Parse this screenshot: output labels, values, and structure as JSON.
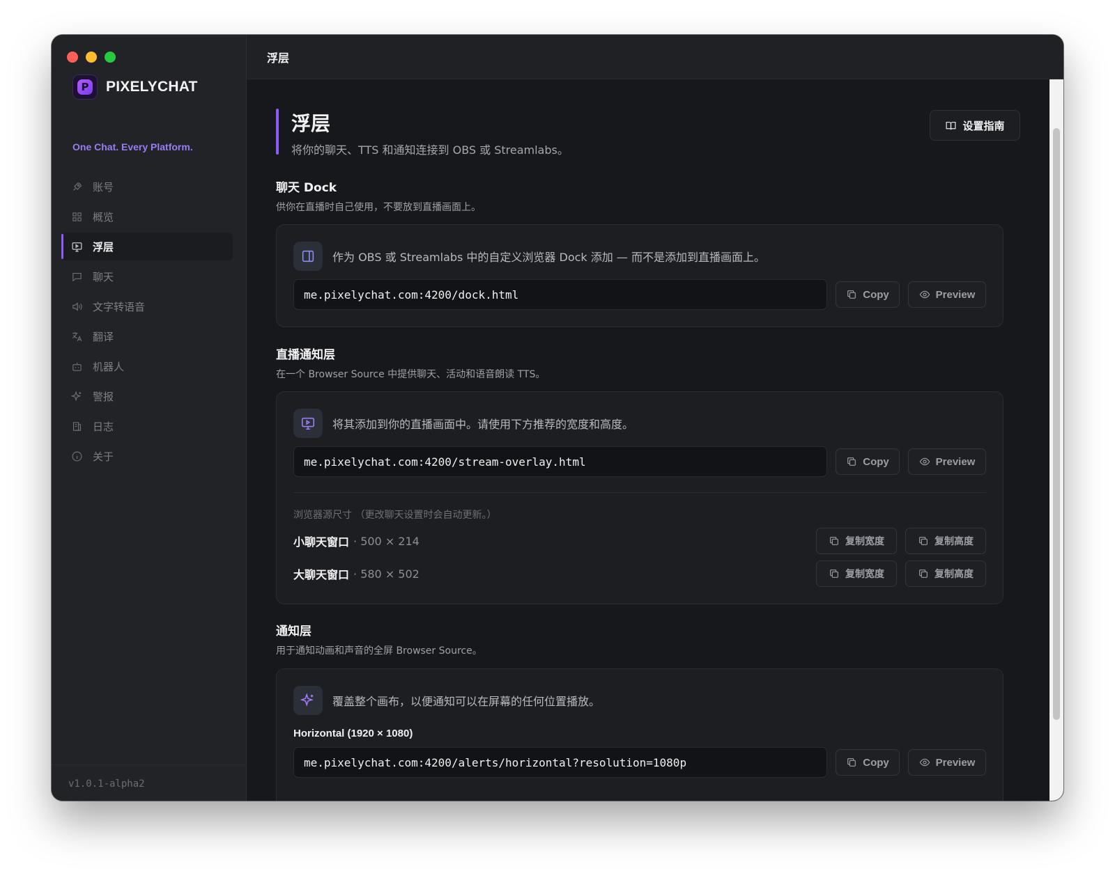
{
  "app": {
    "name": "PIXELYCHAT",
    "tagline": "One Chat. Every Platform.",
    "version": "v1.0.1-alpha2",
    "accent_color": "#8b5cf6"
  },
  "sidebar": {
    "items": [
      {
        "label": "账号",
        "icon": "rocket-icon"
      },
      {
        "label": "概览",
        "icon": "grid-icon"
      },
      {
        "label": "浮层",
        "icon": "monitor-play-icon",
        "active": true
      },
      {
        "label": "聊天",
        "icon": "chat-bubble-icon"
      },
      {
        "label": "文字转语音",
        "icon": "speaker-icon"
      },
      {
        "label": "翻译",
        "icon": "translate-icon"
      },
      {
        "label": "机器人",
        "icon": "bot-icon"
      },
      {
        "label": "警报",
        "icon": "sparkles-icon"
      },
      {
        "label": "日志",
        "icon": "log-icon"
      },
      {
        "label": "关于",
        "icon": "info-icon"
      }
    ]
  },
  "topbar": {
    "title": "浮层"
  },
  "page": {
    "title": "浮层",
    "subtitle": "将你的聊天、TTS 和通知连接到 OBS 或 Streamlabs。",
    "guide_button": "设置指南"
  },
  "buttons": {
    "copy": "Copy",
    "preview": "Preview",
    "copy_width": "复制宽度",
    "copy_height": "复制高度"
  },
  "dock": {
    "title": "聊天 Dock",
    "desc": "供你在直播时自己使用，不要放到直播画面上。",
    "info": "作为 OBS 或 Streamlabs 中的自定义浏览器 Dock 添加 — 而不是添加到直播画面上。",
    "url": "me.pixelychat.com:4200/dock.html"
  },
  "stream_overlay": {
    "title": "直播通知层",
    "desc": "在一个 Browser Source 中提供聊天、活动和语音朗读 TTS。",
    "info": "将其添加到你的直播画面中。请使用下方推荐的宽度和高度。",
    "url": "me.pixelychat.com:4200/stream-overlay.html",
    "dims_label": "浏览器源尺寸 （更改聊天设置时会自动更新。）",
    "sizes": [
      {
        "name": "小聊天窗口",
        "value": "· 500 × 214"
      },
      {
        "name": "大聊天窗口",
        "value": "· 580 × 502"
      }
    ]
  },
  "alerts": {
    "title": "通知层",
    "desc": "用于通知动画和声音的全屏 Browser Source。",
    "info": "覆盖整个画布，以便通知可以在屏幕的任何位置播放。",
    "horizontal_label": "Horizontal (1920 × 1080)",
    "url": "me.pixelychat.com:4200/alerts/horizontal?resolution=1080p"
  }
}
